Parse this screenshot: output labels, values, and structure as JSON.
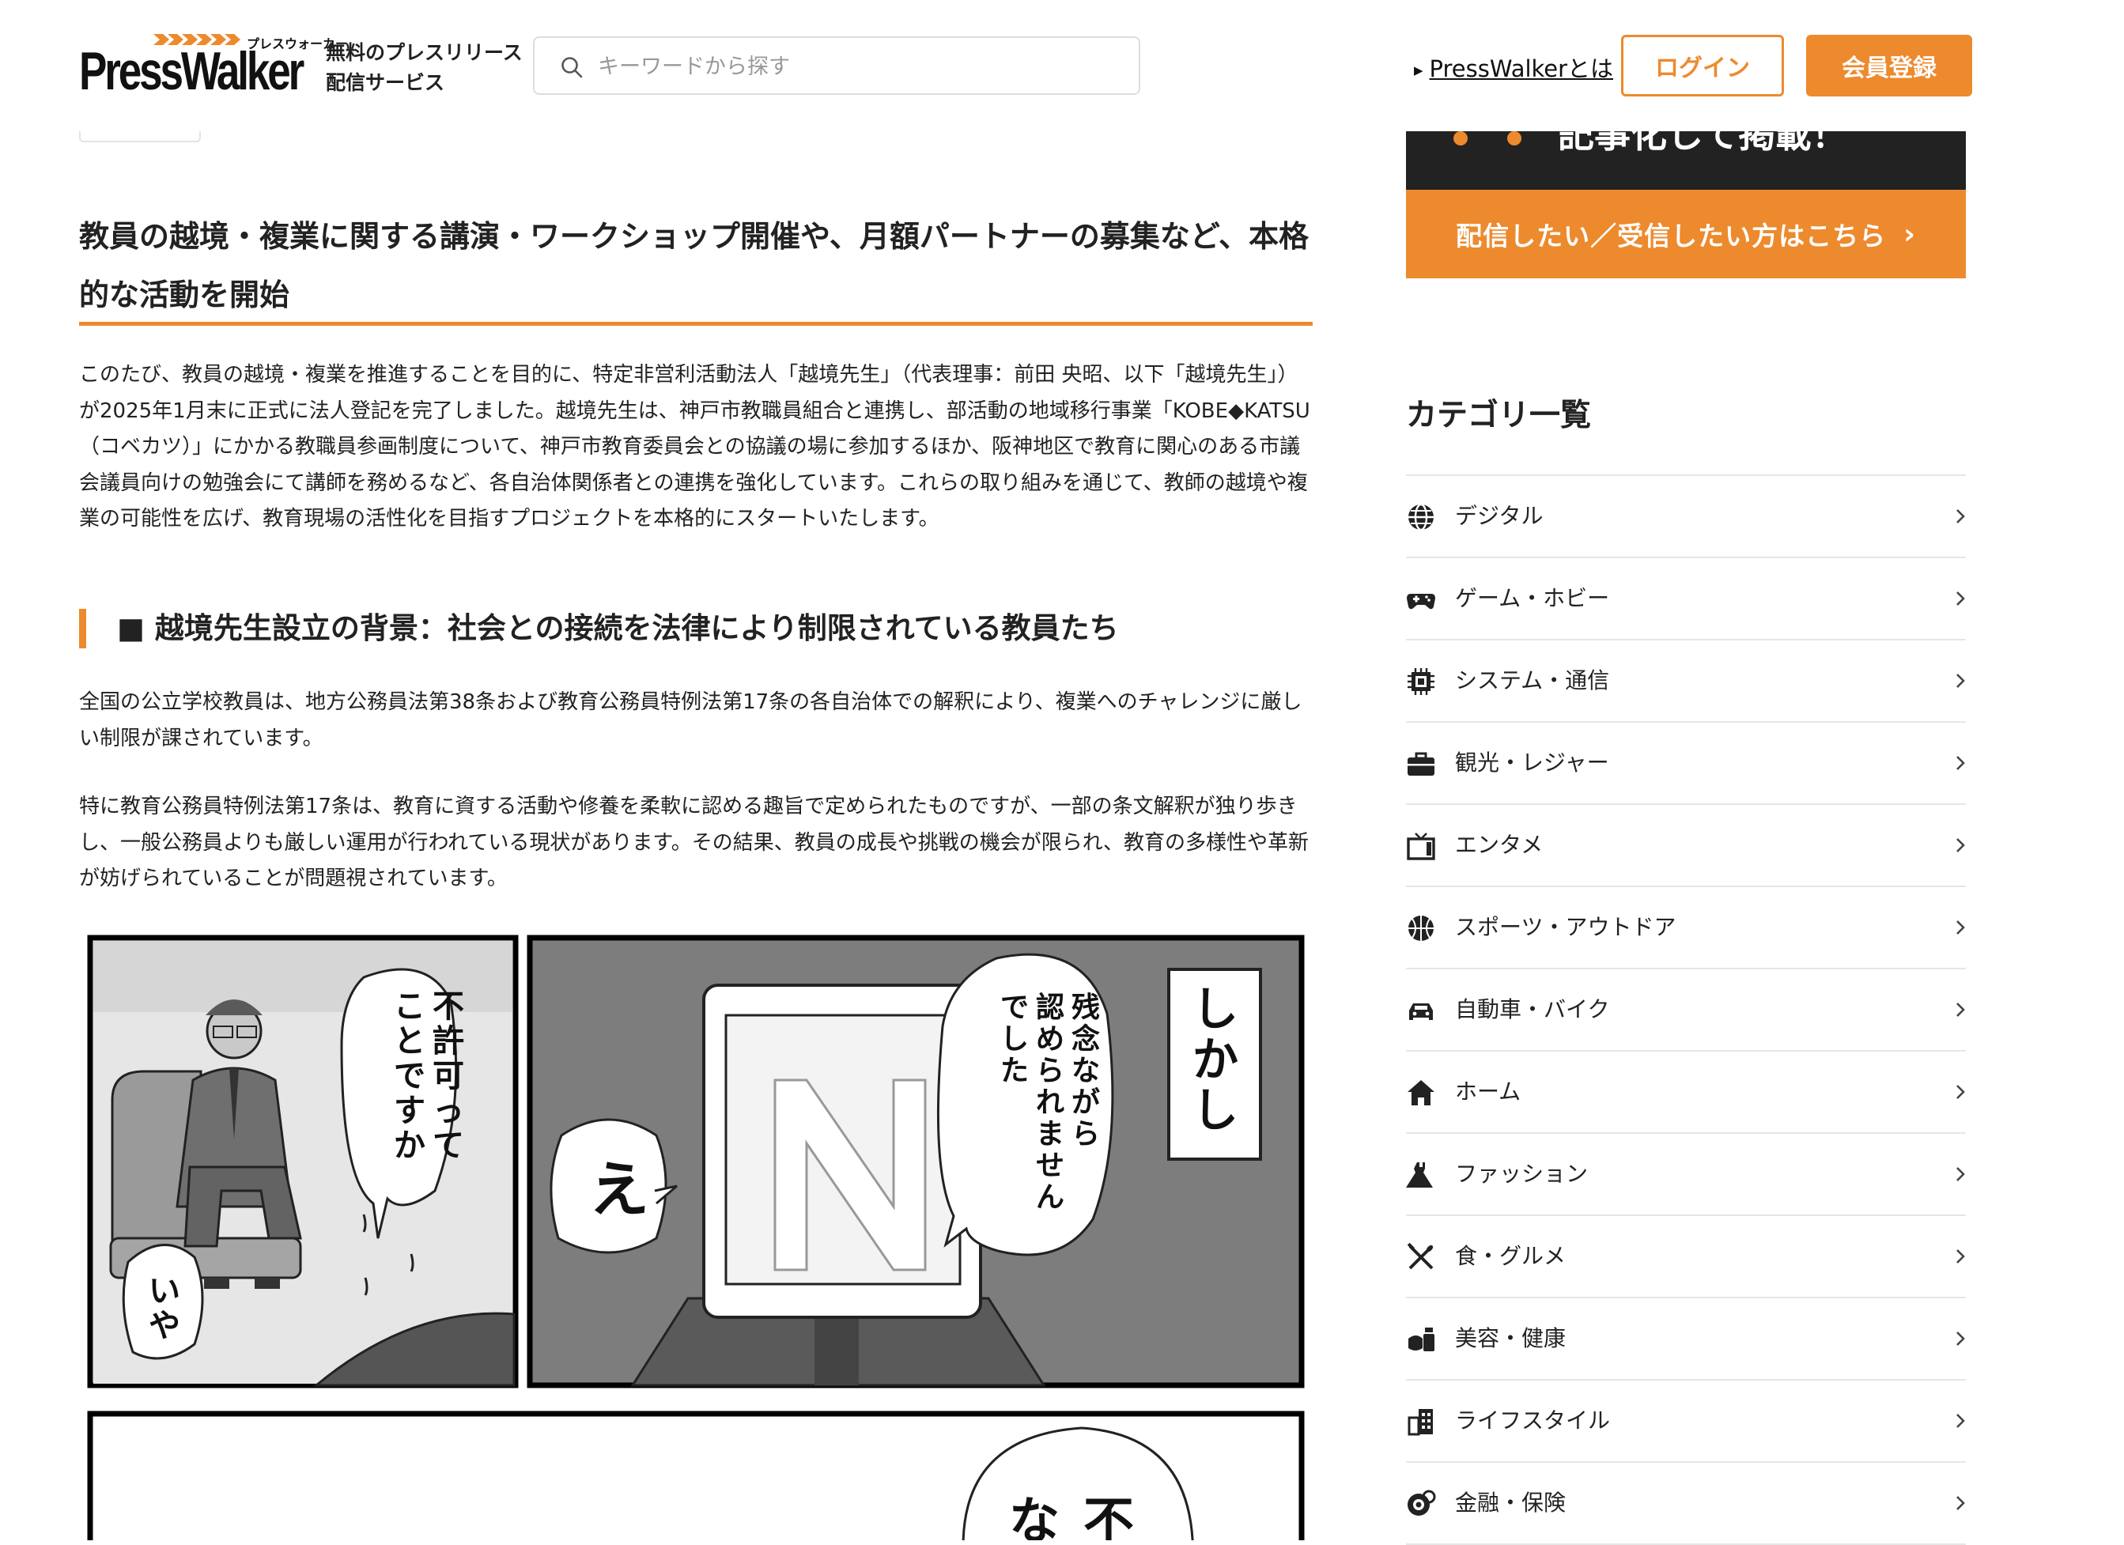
{
  "header": {
    "logo_text": "PressWalker",
    "logo_kana": "プレスウォーカー",
    "tagline_line1": "無料のプレスリリース",
    "tagline_line2": "配信サービス",
    "search_placeholder": "キーワードから探す",
    "about_link": "PressWalkerとは",
    "login_label": "ログイン",
    "signup_label": "会員登録"
  },
  "article": {
    "title": "教員の越境・複業に関する講演・ワークショップ開催や、月額パートナーの募集など、本格的な活動を開始",
    "intro": "このたび、教員の越境・複業を推進することを目的に、特定非営利活動法人「越境先生」（代表理事：前田 央昭、以下「越境先生」）が2025年1月末に正式に法人登記を完了しました。越境先生は、神戸市教職員組合と連携し、部活動の地域移行事業「KOBE◆KATSU（コベカツ）」にかかる教職員参画制度について、神戸市教育委員会との協議の場に参加するほか、阪神地区で教育に関心のある市議会議員向けの勉強会にて講師を務めるなど、各自治体関係者との連携を強化しています。これらの取り組みを通じて、教師の越境や複業の可能性を広げ、教育現場の活性化を目指すプロジェクトを本格的にスタートいたします。",
    "section_heading": "■ 越境先生設立の背景：社会との接続を法律により制限されている教員たち",
    "para2": "全国の公立学校教員は、地方公務員法第38条および教育公務員特例法第17条の各自治体での解釈により、複業へのチャレンジに厳しい制限が課されています。",
    "para3": "特に教育公務員特例法第17条は、教育に資する活動や修養を柔軟に認める趣旨で定められたものですが、一部の条文解釈が独り歩きし、一般公務員よりも厳しい運用が行われている現状があります。その結果、教員の成長や挑戦の機会が限られ、教育の多様性や革新が妨げられていることが問題視されています。",
    "manga": {
      "bubble1": "不許可ってことですか",
      "bubble2": "いや",
      "bubble3": "残念ながら認められませんでした",
      "bubble4": "え",
      "caption": "しかし",
      "bubble5": "不な"
    }
  },
  "sidebar": {
    "promo_partial": "記事化して掲載！",
    "promo_cta": "配信したい／受信したい方はこちら",
    "category_title": "カテゴリ一覧",
    "categories": [
      {
        "label": "デジタル",
        "icon": "globe-icon"
      },
      {
        "label": "ゲーム・ホビー",
        "icon": "gamepad-icon"
      },
      {
        "label": "システム・通信",
        "icon": "chip-icon"
      },
      {
        "label": "観光・レジャー",
        "icon": "suitcase-icon"
      },
      {
        "label": "エンタメ",
        "icon": "tv-icon"
      },
      {
        "label": "スポーツ・アウトドア",
        "icon": "basketball-icon"
      },
      {
        "label": "自動車・バイク",
        "icon": "car-icon"
      },
      {
        "label": "ホーム",
        "icon": "house-icon"
      },
      {
        "label": "ファッション",
        "icon": "dress-icon"
      },
      {
        "label": "食・グルメ",
        "icon": "utensils-icon"
      },
      {
        "label": "美容・健康",
        "icon": "cosmetics-icon"
      },
      {
        "label": "ライフスタイル",
        "icon": "building-icon"
      },
      {
        "label": "金融・保険",
        "icon": "coins-icon"
      }
    ]
  },
  "colors": {
    "accent": "#ed8a2d",
    "dark": "#222222",
    "text": "#222222"
  }
}
